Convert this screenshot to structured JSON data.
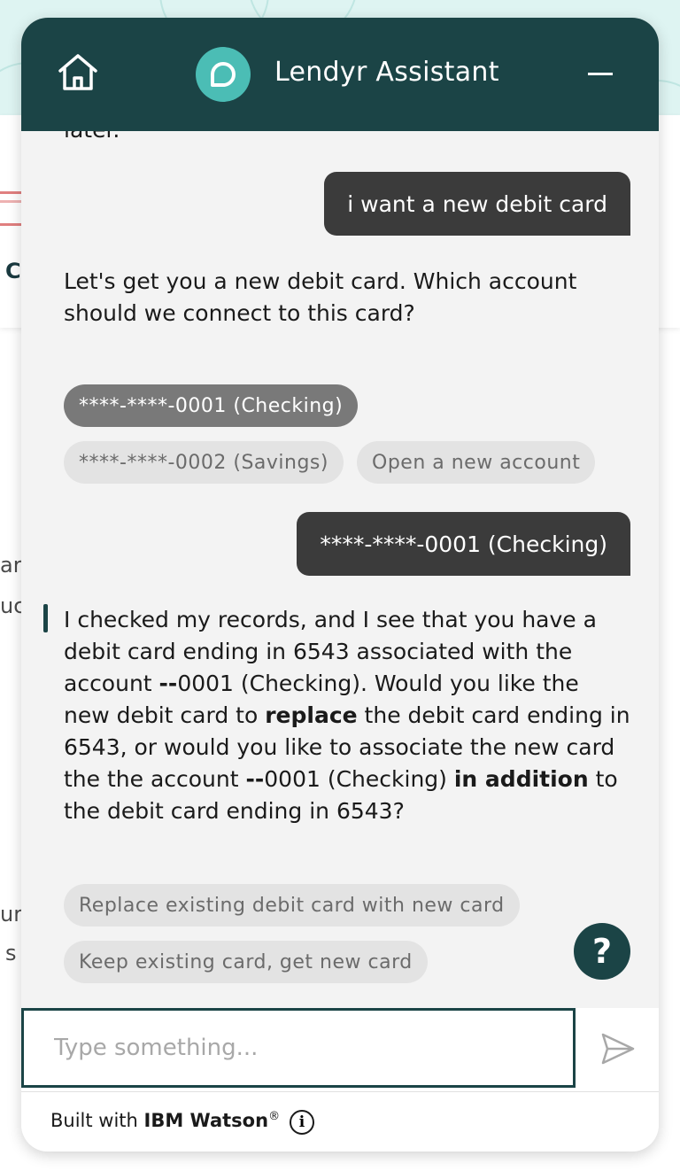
{
  "background": {
    "fragments": [
      "C",
      "ar",
      "uc",
      "ur",
      "s"
    ]
  },
  "header": {
    "title": "Lendyr Assistant",
    "home_icon": "home-icon",
    "avatar_icon": "chat-bubble-icon",
    "minimize_icon": "minimize-icon"
  },
  "conversation": {
    "cut_off_text": "later.",
    "user_message_1": "i want a new debit card",
    "bot_message_1": "Let's get you a new debit card. Which account should we connect to this card?",
    "account_options": [
      {
        "label": "****-****-0001 (Checking)",
        "selected": true
      },
      {
        "label": "****-****-0002 (Savings)",
        "selected": false
      },
      {
        "label": "Open a new account",
        "selected": false
      }
    ],
    "user_message_2": "****-****-0001 (Checking)",
    "bot_message_2": {
      "part1": "I checked my records, and I see that you have a debit card ending in 6543 associated with the account ",
      "bold1": "--",
      "part2": "0001 (Checking). Would you like the new debit card to ",
      "bold2": "replace",
      "part3": " the debit card ending in 6543, or would you like to associate the new card the the account ",
      "bold3": "--",
      "part4": "0001 (Checking) ",
      "bold4": "in addition",
      "part5": " to the debit card ending in 6543?"
    },
    "card_options": [
      {
        "label": "Replace existing debit card with new card"
      },
      {
        "label": "Keep existing card, get new card"
      }
    ]
  },
  "help_button": {
    "label": "?"
  },
  "input": {
    "value": "",
    "placeholder": "Type something..."
  },
  "footer": {
    "prefix": "Built with ",
    "brand": "IBM Watson",
    "registered": "®",
    "info_label": "i"
  },
  "colors": {
    "header": "#1b4446",
    "avatar": "#4bbdb5",
    "user_bubble": "#3b3b3b",
    "chip": "#e3e3e3",
    "chip_selected": "#797979",
    "panel": "#f3f3f3"
  }
}
